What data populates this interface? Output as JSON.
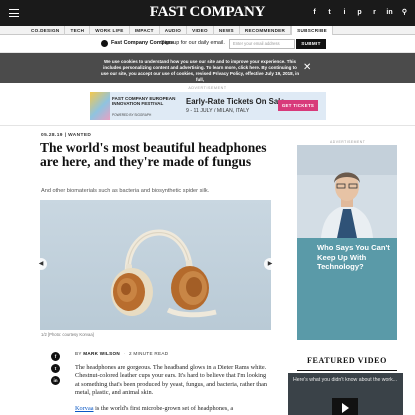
{
  "header": {
    "logo": "FAST COMPANY",
    "social": [
      "f",
      "t",
      "i",
      "p",
      "r",
      "in"
    ]
  },
  "nav": {
    "items": [
      "CO.DESIGN",
      "TECH",
      "WORK LIFE",
      "IMPACT",
      "AUDIO",
      "VIDEO",
      "NEWS",
      "RECOMMENDER",
      "SUBSCRIBE"
    ]
  },
  "compass": {
    "name": "Fast Company Compass",
    "description": "Sign up for our daily email.",
    "email_placeholder": "Enter your email address",
    "submit_label": "SUBMIT"
  },
  "cookie": {
    "text": "We use cookies to understand how you use our site and to improve your experience. This includes personalizing content and advertising. To learn more, click here. By continuing to use our site, you accept our use of cookies, revised Privacy Policy, effective July 19, 2018, in full,",
    "link": "click here"
  },
  "ad": {
    "label": "ADVERTISEMENT",
    "festival": "FAST COMPANY EUROPEAN INNOVATION FESTIVAL",
    "powered": "POWERED BY SIGGRAPH",
    "headline": "Early-Rate Tickets On Sale",
    "sub": "9 - 11 JULY / MILAN, ITALY",
    "button": "GET TICKETS"
  },
  "article": {
    "date": "05.28.19",
    "category": "WANTED",
    "headline": "The world's most beautiful headphones are here, and they're made of fungus",
    "dek": "And other biomaterials such as bacteria and biosynthetic spider silk.",
    "caption": "1/2 [Photo: courtesy Korvaa]",
    "byline_prefix": "BY",
    "author": "MARK WILSON",
    "read_time": "2 MINUTE READ",
    "paragraph1": "The headphones are gorgeous. The headband glows in a Dieter Rams white. Chestnut-colored leather cups your ears. It's hard to believe that I'm looking at something that's been produced by yeast, fungus, and bacteria, rather than metal, plastic, and animal skin.",
    "paragraph2_link": "Korvaa",
    "paragraph2_rest": " is the world's first microbe-grown set of headphones, a"
  },
  "sidebar": {
    "ad_label": "ADVERTISEMENT",
    "ad_text": "Who Says You Can't Keep Up With Technology?",
    "featured_title": "FEATURED VIDEO",
    "featured_caption": "Here's what you didn't know about the work..."
  }
}
